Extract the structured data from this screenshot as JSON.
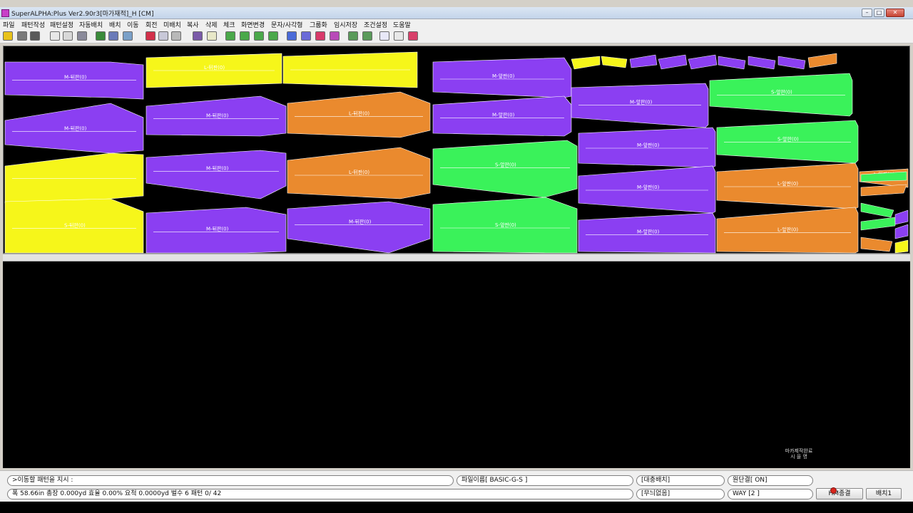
{
  "window": {
    "title": "SuperALPHA:Plus Ver2.90r3[마가재적]_H [CM]"
  },
  "window_controls": {
    "minimize": "–",
    "maximize": "□",
    "close": "✕"
  },
  "menu": [
    "파일",
    "패턴작성",
    "패턴설정",
    "자동배치",
    "배치",
    "이동",
    "회전",
    "미배치",
    "복사",
    "삭제",
    "체크",
    "화면변경",
    "문자/사각형",
    "그룹화",
    "임시저장",
    "조건설정",
    "도움말"
  ],
  "toolbar_icons": [
    {
      "name": "open-folder-icon",
      "color": "#e8c21a"
    },
    {
      "name": "arrow-tool-icon",
      "color": "#7a7a7a"
    },
    {
      "name": "select-arrow-icon",
      "color": "#5a5a5a"
    },
    {
      "name": "page-icon",
      "color": "#e8e8e8"
    },
    {
      "name": "copy-icon",
      "color": "#d8d8d8"
    },
    {
      "name": "wrench-icon",
      "color": "#8a8a9a"
    },
    {
      "name": "flag-icon",
      "color": "#3a8a3a"
    },
    {
      "name": "eye-icon",
      "color": "#6a7ab8"
    },
    {
      "name": "pattern-icon",
      "color": "#7aa0c8"
    },
    {
      "name": "apple-icon",
      "color": "#d2304a"
    },
    {
      "name": "paste-icon",
      "color": "#c8c8d8"
    },
    {
      "name": "ruler-icon",
      "color": "#b8b8b8"
    },
    {
      "name": "pen-icon",
      "color": "#7a5aa8"
    },
    {
      "name": "frame-icon",
      "color": "#e8e8c8"
    },
    {
      "name": "refresh-icon",
      "color": "#4aa84a"
    },
    {
      "name": "move-right-icon",
      "color": "#4aa84a"
    },
    {
      "name": "move-up-icon",
      "color": "#4aa84a"
    },
    {
      "name": "move-down-icon",
      "color": "#4aa84a"
    },
    {
      "name": "rotate-icon",
      "color": "#4a6ad8"
    },
    {
      "name": "diamond-icon",
      "color": "#6a6ad8"
    },
    {
      "name": "flip-icon",
      "color": "#d83a6a"
    },
    {
      "name": "mirror-icon",
      "color": "#b84ab8"
    },
    {
      "name": "group-icon",
      "color": "#5a9a5a"
    },
    {
      "name": "ungroup-icon",
      "color": "#5a9a5a"
    },
    {
      "name": "save-icon",
      "color": "#e8e8f8"
    },
    {
      "name": "check-icon",
      "color": "#e8e8e8"
    },
    {
      "name": "screen-icon",
      "color": "#d8406a"
    }
  ],
  "pieces": [
    {
      "color": "#8b3ff2",
      "label": "M-뒤판(0)"
    },
    {
      "color": "#8b3ff2",
      "label": "M-뒤판(0)"
    },
    {
      "color": "#f6f61a",
      "label": ""
    },
    {
      "color": "#f6f61a",
      "label": "S-뒤판(0)"
    },
    {
      "color": "#f6f61a",
      "label": "L-뒤판(0)"
    },
    {
      "color": "#f6f61a",
      "label": ""
    },
    {
      "color": "#8b3ff2",
      "label": "M-뒤판(0)"
    },
    {
      "color": "#8b3ff2",
      "label": "M-뒤판(0)"
    },
    {
      "color": "#8b3ff2",
      "label": "M-뒤판(0)"
    },
    {
      "color": "#ea8a2e",
      "label": "L-뒤판(0)"
    },
    {
      "color": "#ea8a2e",
      "label": "L-뒤판(0)"
    },
    {
      "color": "#8b3ff2",
      "label": "M-뒤판(0)"
    },
    {
      "color": "#8b3ff2",
      "label": "M-앞판(0)"
    },
    {
      "color": "#8b3ff2",
      "label": "M-앞판(0)"
    },
    {
      "color": "#3af25a",
      "label": "S-앞판(0)"
    },
    {
      "color": "#3af25a",
      "label": "S-앞판(0)"
    },
    {
      "color": "#8b3ff2",
      "label": "M-앞판(0)"
    },
    {
      "color": "#8b3ff2",
      "label": "M-앞판(0)"
    },
    {
      "color": "#8b3ff2",
      "label": "M-앞판(0)"
    },
    {
      "color": "#8b3ff2",
      "label": "M-앞판(0)"
    },
    {
      "color": "#3af25a",
      "label": "S-앞판(0)"
    },
    {
      "color": "#3af25a",
      "label": "S-앞판(0)"
    },
    {
      "color": "#ea8a2e",
      "label": "L-앞판(0)"
    },
    {
      "color": "#ea8a2e",
      "label": "L-앞판(0)"
    },
    {
      "color": "#ea8a2e",
      "label": "L-앞판(0)"
    }
  ],
  "marker_stamp": {
    "line1": "마카제작완료",
    "line2": "시 을 영"
  },
  "status": {
    "command": ">이동할 패턴을 지시 :",
    "filename": "파일이름[ BASIC-G-S ]",
    "layout_mode": "[대충배치]",
    "split": "원단결[ ON]",
    "stats": "폭 58.66in 총장   0.000yd  효율 0.00%  요척 0.0000yd 벌수  6 패턴   0/ 42",
    "pattern_mode": "[무늬없음]",
    "way": "WAY [2 ]",
    "exit_button": "HM종결",
    "layout_button": "배치1"
  }
}
